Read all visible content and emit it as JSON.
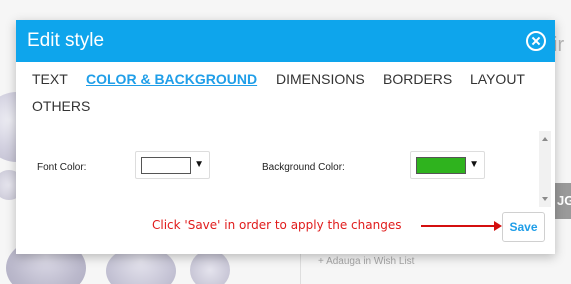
{
  "dialog": {
    "title": "Edit style",
    "tabs": [
      {
        "label": "TEXT",
        "active": false
      },
      {
        "label": "COLOR & BACKGROUND",
        "active": true
      },
      {
        "label": "DIMENSIONS",
        "active": false
      },
      {
        "label": "BORDERS",
        "active": false
      },
      {
        "label": "LAYOUT",
        "active": false
      },
      {
        "label": "OTHERS",
        "active": false
      }
    ],
    "fields": {
      "font_color": {
        "label": "Font Color:",
        "value_color": "#ffffff",
        "caret": "▼"
      },
      "background_color": {
        "label": "Background Color:",
        "value_color": "#2fb31e",
        "caret": "▼"
      }
    },
    "hint": "Click 'Save' in order to apply the changes",
    "save_label": "Save"
  },
  "background": {
    "side_title": "ir",
    "side_tab": "JG",
    "wishlist_text": "+ Adauga in Wish List"
  },
  "colors": {
    "header_blue": "#0ea5ec",
    "accent_blue": "#1f9ee8",
    "hint_red": "#e01b1b"
  }
}
